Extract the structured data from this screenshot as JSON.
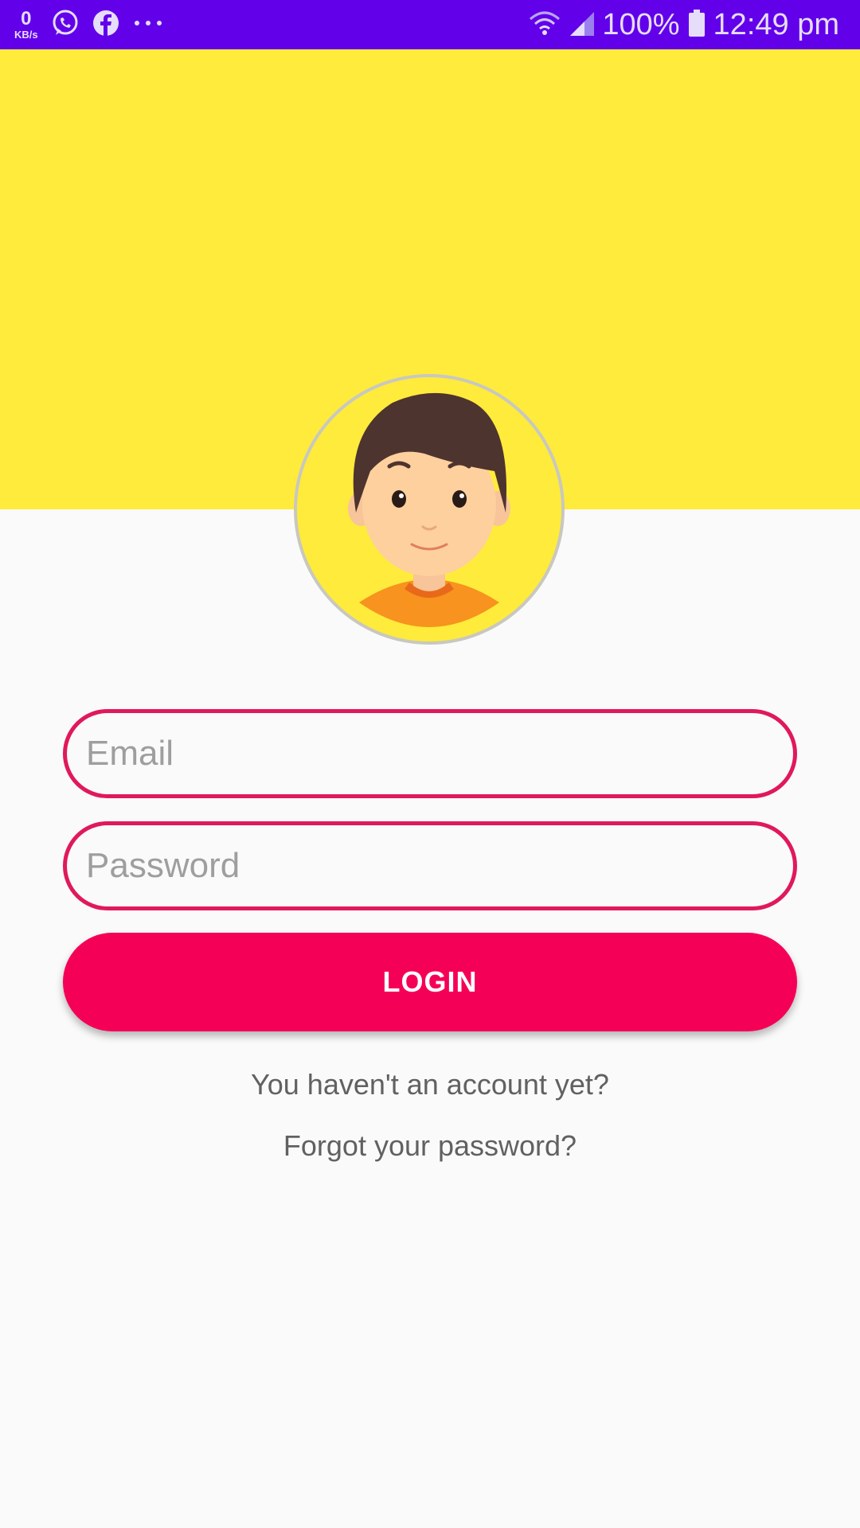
{
  "status_bar": {
    "net_speed_value": "0",
    "net_speed_unit": "KB/s",
    "battery": "100%",
    "time": "12:49 pm",
    "icons": [
      "whatsapp-icon",
      "facebook-icon",
      "more-notifications-icon",
      "wifi-icon",
      "signal-icon",
      "battery-icon"
    ]
  },
  "colors": {
    "status_bar": "#6200EA",
    "header": "#FFEB3B",
    "accent": "#F50057",
    "field_border": "#E0195A",
    "background": "#FAFAFA"
  },
  "form": {
    "email_placeholder": "Email",
    "email_value": "",
    "password_placeholder": "Password",
    "password_value": "",
    "login_label": "LOGIN"
  },
  "links": {
    "signup": "You haven't an account yet?",
    "forgot": "Forgot your password?"
  }
}
